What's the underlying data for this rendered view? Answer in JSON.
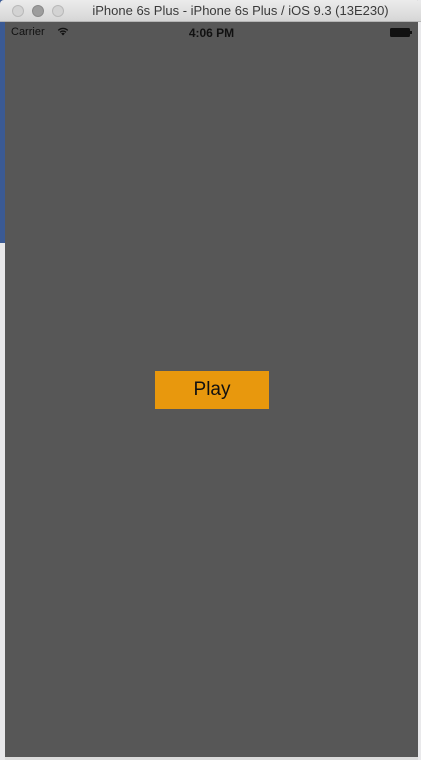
{
  "window": {
    "title": "iPhone 6s Plus - iPhone 6s Plus / iOS 9.3 (13E230)"
  },
  "statusbar": {
    "carrier": "Carrier",
    "time": "4:06 PM",
    "wifi_icon": "wifi-icon",
    "battery_icon": "battery-icon"
  },
  "app": {
    "play_label": "Play"
  },
  "colors": {
    "screen_background": "#575757",
    "play_button": "#e8980d"
  }
}
